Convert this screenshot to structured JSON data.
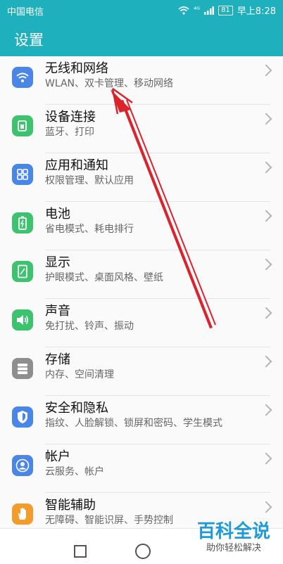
{
  "status_bar": {
    "carrier": "中国电信",
    "signal_text": "⁴ᴳ",
    "battery": "81",
    "time": "早上8:28"
  },
  "header": {
    "title": "设置"
  },
  "items": [
    {
      "title": "无线和网络",
      "subtitle": "WLAN、双卡管理、移动网络",
      "icon": "wifi-icon",
      "color": "#4a86e8"
    },
    {
      "title": "设备连接",
      "subtitle": "蓝牙、打印",
      "icon": "device-connect-icon",
      "color": "#3dc36e"
    },
    {
      "title": "应用和通知",
      "subtitle": "权限管理、默认应用",
      "icon": "apps-grid-icon",
      "color": "#4a86e8"
    },
    {
      "title": "电池",
      "subtitle": "省电模式、耗电排行",
      "icon": "battery-icon",
      "color": "#3dc36e"
    },
    {
      "title": "显示",
      "subtitle": "护眼模式、桌面风格、壁纸",
      "icon": "display-icon",
      "color": "#3dc36e"
    },
    {
      "title": "声音",
      "subtitle": "免打扰、铃声、振动",
      "icon": "speaker-icon",
      "color": "#3dc36e"
    },
    {
      "title": "存储",
      "subtitle": "内存、空间清理",
      "icon": "storage-icon",
      "color": "#8e8e8e"
    },
    {
      "title": "安全和隐私",
      "subtitle": "指纹、人脸解锁、锁屏和密码、学生模式",
      "icon": "shield-icon",
      "color": "#4a86e8"
    },
    {
      "title": "帐户",
      "subtitle": "云服务、帐户",
      "icon": "account-icon",
      "color": "#4a86e8"
    },
    {
      "title": "智能辅助",
      "subtitle": "无障碍、智能识屏、手势控制",
      "icon": "hand-icon",
      "color": "#f39c2b"
    }
  ],
  "watermark": {
    "big": "百科全说",
    "small": "助你轻松解决"
  },
  "colors": {
    "header_bg": "#1fb0bd",
    "arrow": "#d9232d"
  }
}
